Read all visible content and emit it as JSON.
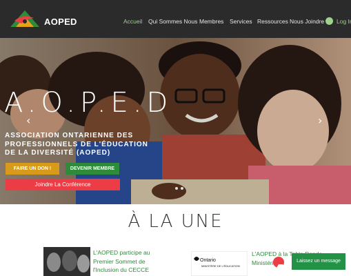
{
  "header": {
    "brand": "AOPED",
    "nav": [
      "Accueil",
      "Qui Sommes Nous",
      "Membres",
      "Services",
      "Ressources",
      "Nous Joindre"
    ],
    "active_nav": "Accueil",
    "login_label": "Log In"
  },
  "hero": {
    "big_title": "A.O.P.E.D",
    "subtitle": "ASSOCIATION ONTARIENNE DES PROFESSIONNELS DE L'ÉDUCATION DE LA DIVERSITÉ (AOPED)",
    "btn_don": "FAIRE UN DON !",
    "btn_membre": "DEVENIR MEMBRE",
    "btn_conf": "Joindre La Conférence",
    "prev_arrow": "‹",
    "next_arrow": "›"
  },
  "section": {
    "title": "À LA UNE",
    "news": [
      {
        "title": "L'AOPED participe au Premier Sommet de l'Inclusion du CECCE"
      },
      {
        "title": "L'AOPED à la Table Ronde Ministérielle",
        "logo_line1": "Ontario",
        "logo_line2": "MINISTÈRE DE L'ÉDUCATION"
      }
    ]
  },
  "chat": {
    "label": "Laissez un message"
  },
  "colors": {
    "header_bg": "#2b2b2b",
    "accent_green": "#2e8b3a",
    "accent_orange": "#d79a1a",
    "accent_red": "#ec3d46"
  }
}
